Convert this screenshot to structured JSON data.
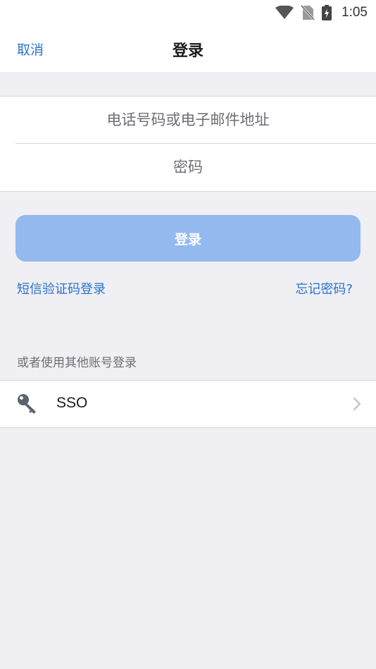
{
  "status_bar": {
    "time": "1:05",
    "icons": [
      "wifi-icon",
      "no-sim-icon",
      "battery-charging-icon"
    ]
  },
  "nav": {
    "cancel_label": "取消",
    "title": "登录"
  },
  "form": {
    "account_placeholder": "电话号码或电子邮件地址",
    "password_placeholder": "密码"
  },
  "login_button_label": "登录",
  "links": {
    "sms_login": "短信验证码登录",
    "forgot_password": "忘记密码?"
  },
  "other_accounts": {
    "label": "或者使用其他账号登录",
    "items": [
      {
        "label": "SSO",
        "icon": "key-icon"
      }
    ]
  },
  "colors": {
    "accent": "#2a73c9",
    "button_disabled": "#93b9ef",
    "background": "#efeff4"
  }
}
